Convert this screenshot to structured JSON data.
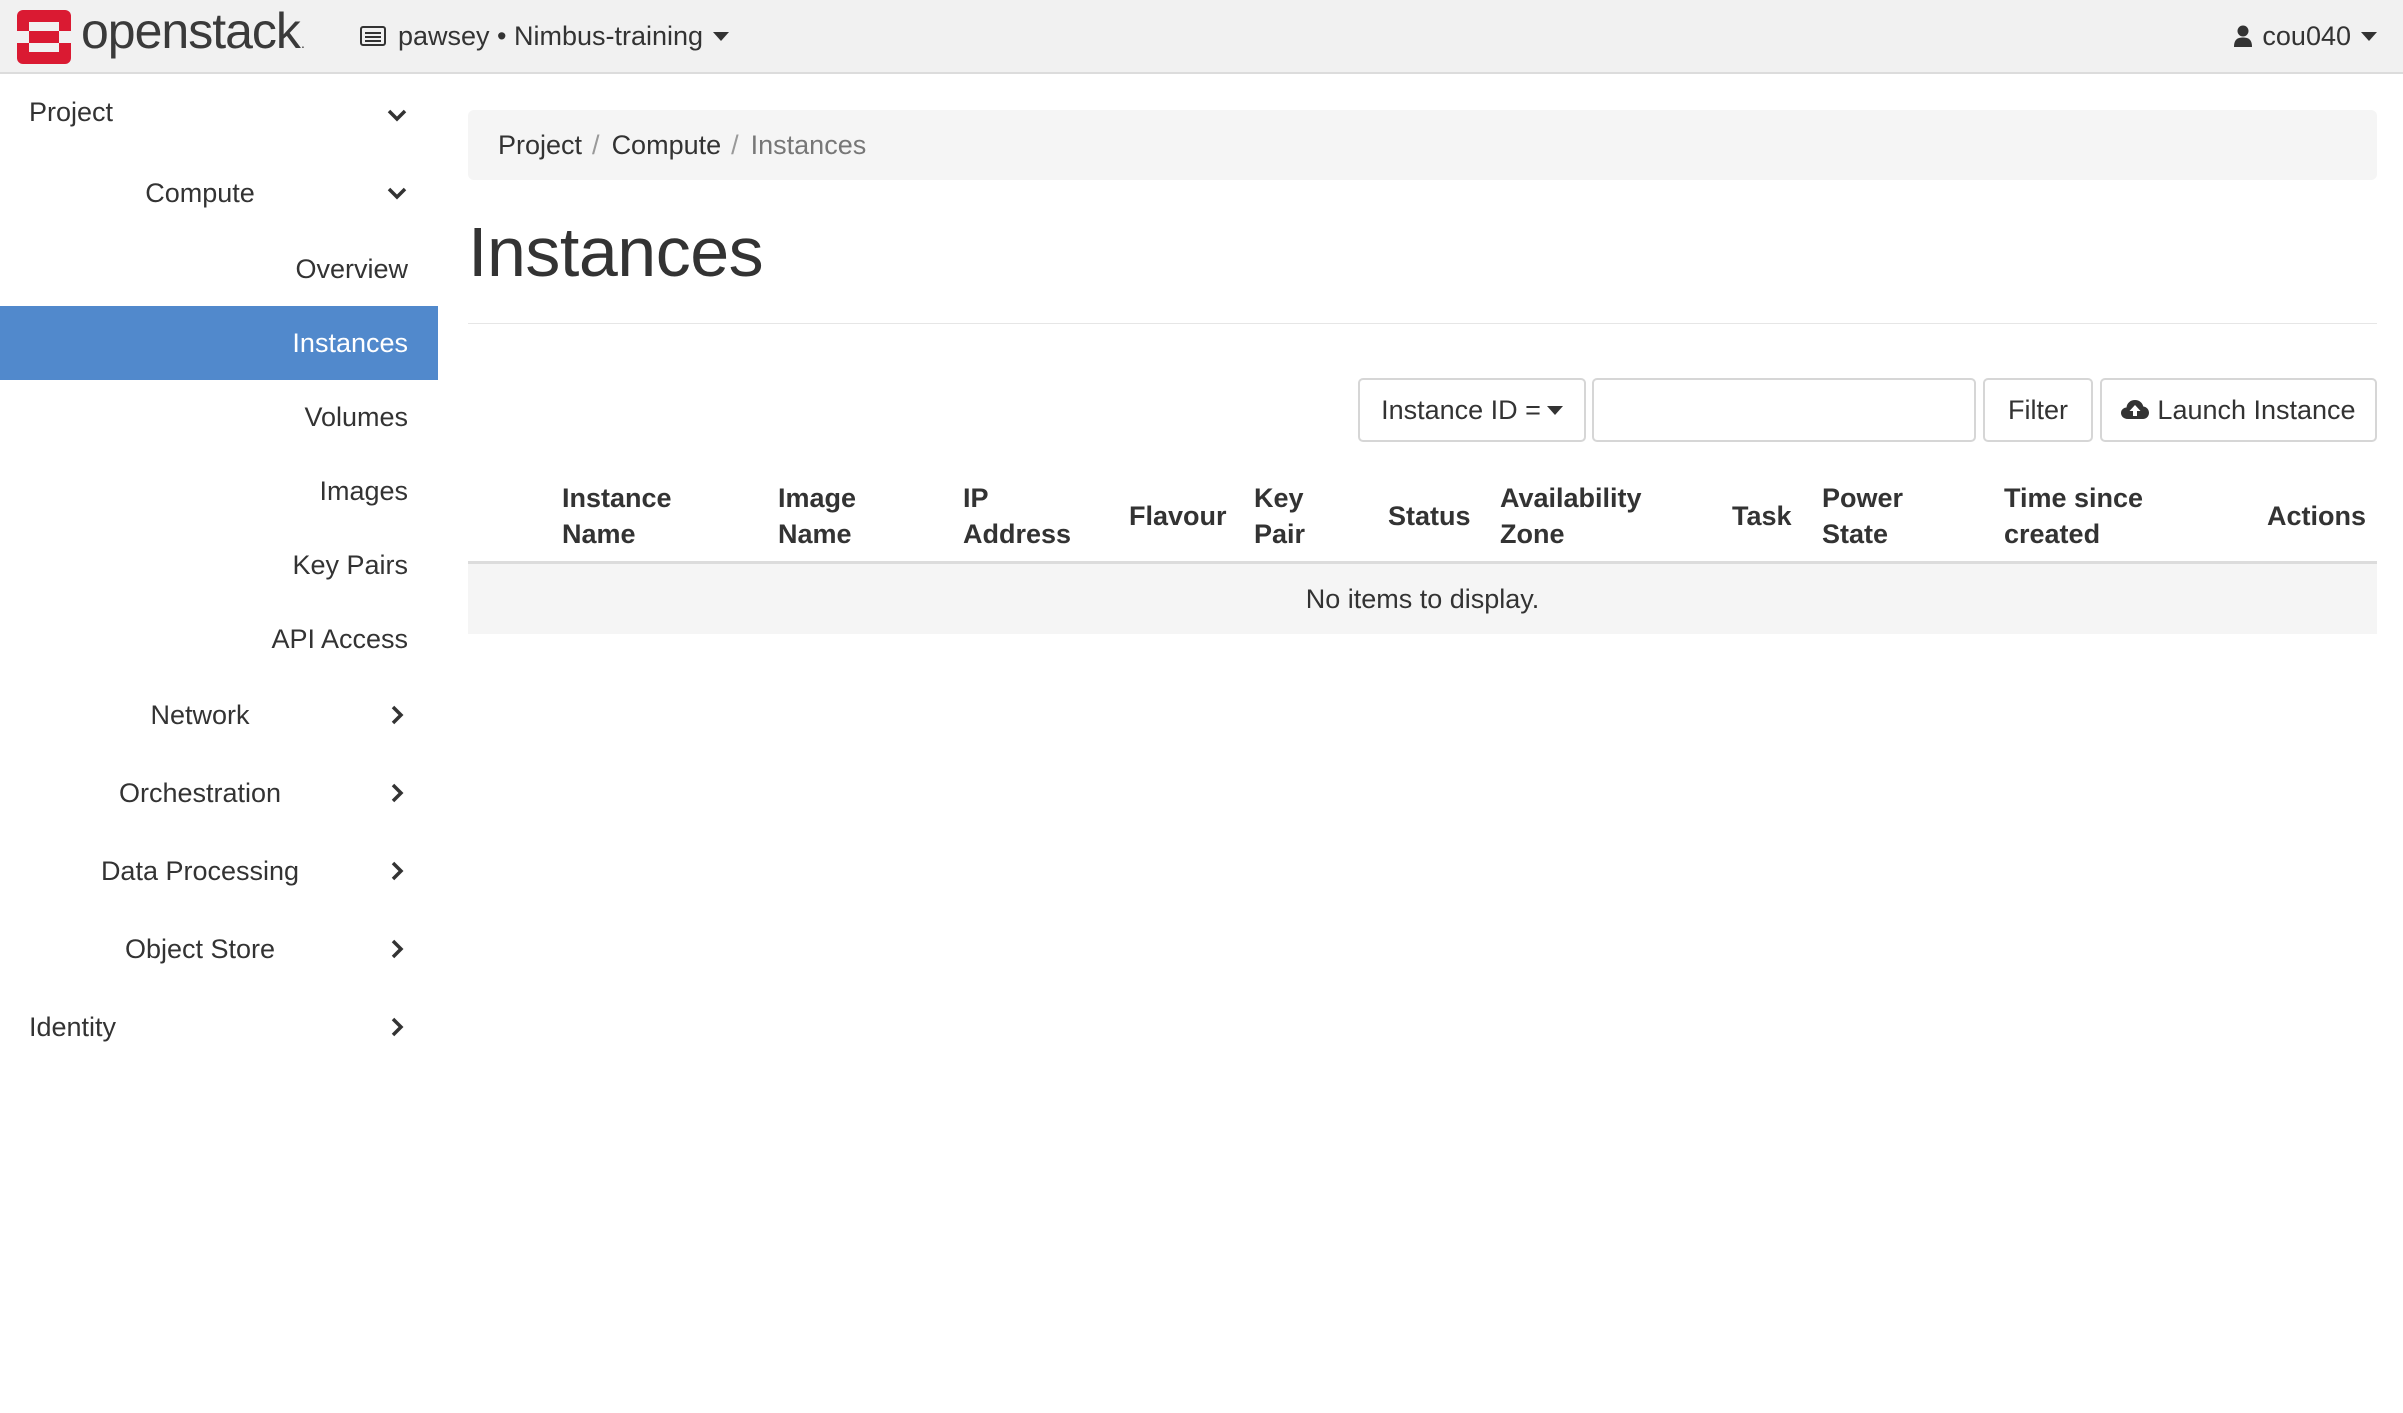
{
  "brand": {
    "name": "openstack",
    "mark": "."
  },
  "navbar": {
    "project_selector": "pawsey • Nimbus-training",
    "user": "cou040"
  },
  "sidebar": {
    "project": "Project",
    "compute": "Compute",
    "compute_items": [
      "Overview",
      "Instances",
      "Volumes",
      "Images",
      "Key Pairs",
      "API Access"
    ],
    "active_item": "Instances",
    "network": "Network",
    "orchestration": "Orchestration",
    "data_processing": "Data Processing",
    "object_store": "Object Store",
    "identity": "Identity"
  },
  "breadcrumb": [
    "Project",
    "Compute",
    "Instances"
  ],
  "page": {
    "title": "Instances"
  },
  "toolbar": {
    "filter_field": "Instance ID =",
    "filter_value": "",
    "filter_button": "Filter",
    "launch_button": "Launch Instance"
  },
  "table": {
    "columns": [
      "Instance\nName",
      "Image\nName",
      "IP\nAddress",
      "Flavour",
      "Key\nPair",
      "Status",
      "Availability\nZone",
      "Task",
      "Power\nState",
      "Time since\ncreated",
      "Actions"
    ],
    "empty_message": "No items to display."
  },
  "colors": {
    "active": "#5189cc",
    "brand_red": "#da1a32",
    "navbar": "#f1f1f1"
  },
  "icons": {
    "logo": "openstack-logo-icon",
    "project": "project-list-icon",
    "user": "user-icon",
    "launch": "cloud-upload-icon",
    "expanded": "chevron-down-icon",
    "collapsed": "chevron-right-icon"
  }
}
